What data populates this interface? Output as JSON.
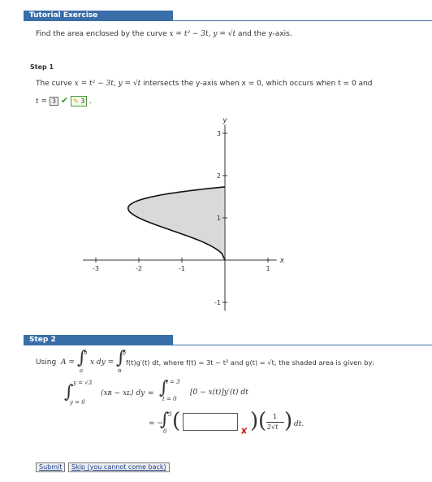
{
  "tutorial": {
    "title": "Tutorial Exercise",
    "problem": "Find the area enclosed by the curve",
    "problem_math": "x = t² − 3t, y = √t",
    "problem_tail": "and the y-axis."
  },
  "step1": {
    "label": "Step 1",
    "sentence_a": "The curve",
    "sentence_math": "x = t² − 3t, y = √t",
    "sentence_b": "intersects the y-axis when x = 0, which occurs when",
    "sentence_c": "t = 0 and",
    "t_prefix": "t =",
    "answer_value": "3",
    "hint_value": "3",
    "period": "."
  },
  "graph": {
    "x_axis_label": "x",
    "y_axis_label": "y",
    "x_ticks": [
      "-3",
      "-2",
      "-1",
      "1"
    ],
    "y_ticks": [
      "3",
      "2",
      "1",
      "-1"
    ],
    "fill_color": "#d9d9d9"
  },
  "step2": {
    "label": "Step 2",
    "using": "Using",
    "A_eq": "A =",
    "integrand1": "x dy =",
    "integrand2": "f(t)g′(t) dt, where f(t) = 3t − t² and g(t) = √t, the shaded area is given by:",
    "int1_upper_a": "b",
    "int1_lower_a": "a",
    "int2_upper": "β",
    "int2_lower": "α",
    "row2_upper": "y = √3",
    "row2_lower": "y = 0",
    "row2_integrand": "(xʀ − xʟ) dy",
    "row2_eq": "=",
    "row2_upper_t": "t = 3",
    "row2_lower_t": "t = 0",
    "row2_integrand_t": "[0 − x(t)]y′(t) dt",
    "row3_prefix": "= −",
    "row3_upper": "3",
    "row3_lower": "0",
    "frac_num": "1",
    "frac_den": "2√t",
    "row3_tail": "dt.",
    "input_value": ""
  },
  "buttons": {
    "submit": "Submit",
    "skip": "Skip (you cannot come back)"
  }
}
